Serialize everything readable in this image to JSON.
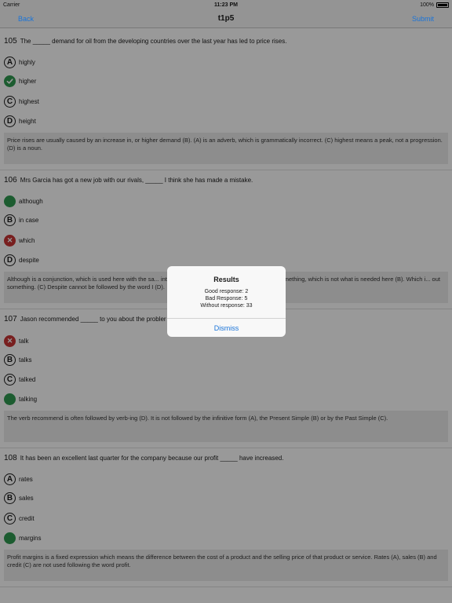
{
  "status": {
    "carrier": "Carrier",
    "time": "11:23 PM",
    "battery": "100%"
  },
  "nav": {
    "back": "Back",
    "title": "t1p5",
    "submit": "Submit"
  },
  "questions": [
    {
      "number": "105",
      "text": "The _____ demand for oil from the developing countries over the last year has led to price rises.",
      "options": [
        {
          "letter": "A",
          "text": "highly",
          "state": "normal"
        },
        {
          "letter": "",
          "text": "higher",
          "state": "correct"
        },
        {
          "letter": "C",
          "text": "highest",
          "state": "normal"
        },
        {
          "letter": "D",
          "text": "height",
          "state": "normal"
        }
      ],
      "explanation": "Price rises are usually caused by an increase in, or higher demand (B). (A) is an adverb, which is grammatically incorrect. (C) highest means a peak, not a progression. (D) is a noun."
    },
    {
      "number": "106",
      "text": "Mrs Garcia has got a new job with our rivals, _____ I think she has made a mistake.",
      "options": [
        {
          "letter": "",
          "text": "although",
          "state": "green"
        },
        {
          "letter": "B",
          "text": "in case",
          "state": "normal"
        },
        {
          "letter": "✕",
          "text": "which",
          "state": "wrong"
        },
        {
          "letter": "D",
          "text": "despite",
          "state": "normal"
        }
      ],
      "explanation": "Although is a conjunction, which is used here with the sa... introduce an explanation or reason for doing something, which is not what is needed here (B). Which i... out something. (C) Despite cannot be followed by the word I (D)."
    },
    {
      "number": "107",
      "text": "Jason recommended _____ to you about the probler",
      "options": [
        {
          "letter": "✕",
          "text": "talk",
          "state": "wrong"
        },
        {
          "letter": "B",
          "text": "talks",
          "state": "normal"
        },
        {
          "letter": "C",
          "text": "talked",
          "state": "normal"
        },
        {
          "letter": "",
          "text": "talking",
          "state": "green"
        }
      ],
      "explanation": "The verb recommend is often followed by verb-ing (D). It is not followed by the infinitive form (A), the Present Simple (B) or by the Past Simple (C)."
    },
    {
      "number": "108",
      "text": "It has been an excellent last quarter for the company because our profit _____ have increased.",
      "options": [
        {
          "letter": "A",
          "text": "rates",
          "state": "normal"
        },
        {
          "letter": "B",
          "text": "sales",
          "state": "normal"
        },
        {
          "letter": "C",
          "text": "credit",
          "state": "normal"
        },
        {
          "letter": "",
          "text": "margins",
          "state": "green"
        }
      ],
      "explanation": "Profit margins is a fixed expression which means the difference between the cost of a product and the selling price of that product or service. Rates (A), sales (B) and credit (C) are not used following the word profit."
    }
  ],
  "dialog": {
    "title": "Results",
    "lines": [
      "Good response: 2",
      "Bad Response: 5",
      "Without response: 33"
    ],
    "dismiss": "Dismiss"
  },
  "colors": {
    "accent": "#1a74d9",
    "correct": "#2f9a50",
    "wrong": "#c83434"
  }
}
